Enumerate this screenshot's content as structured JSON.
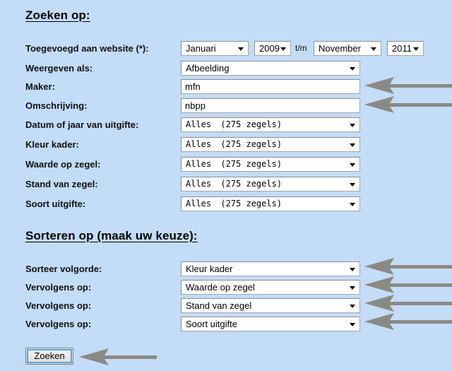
{
  "page": {
    "background_color": "#c3dcf7",
    "arrow_color": "#8a8a84"
  },
  "search_section": {
    "heading": "Zoeken op:",
    "rows": [
      {
        "label": "Toegevoegd aan website (*):",
        "type": "date-range",
        "from_month": "Januari",
        "from_year": "2009",
        "separator": "t/m",
        "to_month": "November",
        "to_year": "2011"
      },
      {
        "label": "Weergeven als:",
        "type": "select",
        "value": "Afbeelding"
      },
      {
        "label": "Maker:",
        "type": "text",
        "value": "mfn",
        "placeholder": ""
      },
      {
        "label": "Omschrijving:",
        "type": "text",
        "value": "nbpp",
        "placeholder": ""
      },
      {
        "label": "Datum of jaar van uitgifte:",
        "type": "select-mono",
        "value": "Alles",
        "count": "(275 zegels)"
      },
      {
        "label": "Kleur kader:",
        "type": "select-mono",
        "value": "Alles",
        "count": "(275 zegels)"
      },
      {
        "label": "Waarde op zegel:",
        "type": "select-mono",
        "value": "Alles",
        "count": "(275 zegels)"
      },
      {
        "label": "Stand van zegel:",
        "type": "select-mono",
        "value": "Alles",
        "count": "(275 zegels)"
      },
      {
        "label": "Soort uitgifte:",
        "type": "select-mono",
        "value": "Alles",
        "count": "(275 zegels)"
      }
    ]
  },
  "sort_section": {
    "heading": "Sorteren op (maak uw keuze):",
    "rows": [
      {
        "label": "Sorteer volgorde:",
        "value": "Kleur kader"
      },
      {
        "label": "Vervolgens op:",
        "value": "Waarde op zegel"
      },
      {
        "label": "Vervolgens op:",
        "value": "Stand van zegel"
      },
      {
        "label": "Vervolgens op:",
        "value": "Soort uitgifte"
      }
    ]
  },
  "actions": {
    "submit_label": "Zoeken"
  },
  "annotations": {
    "arrow_icon": "left-pointing-arrow"
  }
}
